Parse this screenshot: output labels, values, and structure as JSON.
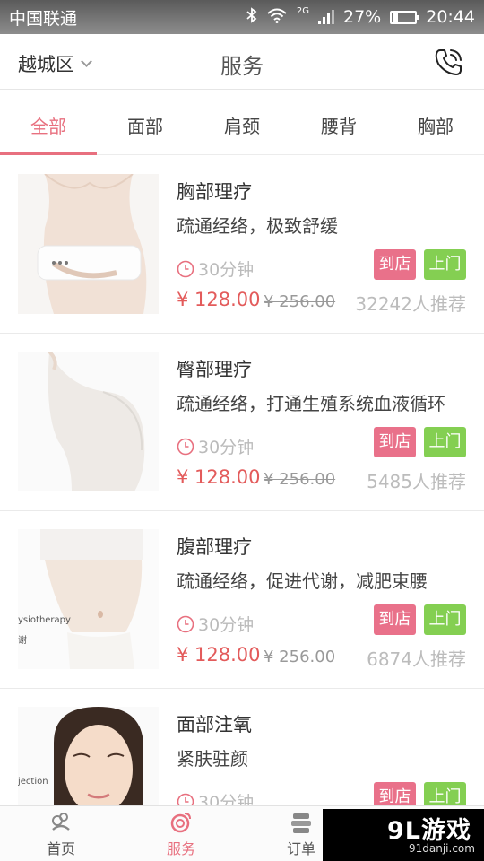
{
  "status_bar": {
    "carrier": "中国联通",
    "network": "2G",
    "battery_percent_text": "27%",
    "battery_level": 0.27,
    "time": "20:44"
  },
  "header": {
    "district": "越城区",
    "title": "服务",
    "call_icon": "phone-call-icon"
  },
  "tabs": [
    {
      "label": "全部",
      "active": true
    },
    {
      "label": "面部",
      "active": false
    },
    {
      "label": "肩颈",
      "active": false
    },
    {
      "label": "腰背",
      "active": false
    },
    {
      "label": "胸部",
      "active": false
    }
  ],
  "services": [
    {
      "name": "胸部理疗",
      "description": "疏通经络，极致舒缓",
      "duration": "30分钟",
      "store_label": "到店",
      "home_label": "上门",
      "price": "¥ 128.00",
      "original_price": "¥ 256.00",
      "recommend": "32242人推荐",
      "overlay": ""
    },
    {
      "name": "臀部理疗",
      "description": "疏通经络，打通生殖系统血液循环",
      "duration": "30分钟",
      "store_label": "到店",
      "home_label": "上门",
      "price": "¥ 128.00",
      "original_price": "¥ 256.00",
      "recommend": "5485人推荐",
      "overlay": ""
    },
    {
      "name": "腹部理疗",
      "description": "疏通经络，促进代谢，减肥束腰",
      "duration": "30分钟",
      "store_label": "到店",
      "home_label": "上门",
      "price": "¥ 128.00",
      "original_price": "¥ 256.00",
      "recommend": "6874人推荐",
      "overlay": "ysiotherapy",
      "overlay2": "谢"
    },
    {
      "name": "面部注氧",
      "description": "紧肤驻颜",
      "duration": "30分钟",
      "store_label": "到店",
      "home_label": "上门",
      "overlay": "jection"
    }
  ],
  "bottom_nav": [
    {
      "label": "首页",
      "icon": "home-icon",
      "active": false
    },
    {
      "label": "服务",
      "icon": "service-icon",
      "active": true
    },
    {
      "label": "订单",
      "icon": "order-icon",
      "active": false
    }
  ],
  "watermark": {
    "logo": "9L游戏",
    "url": "91danji.com"
  },
  "colors": {
    "accent": "#e8707f",
    "store_badge": "#e9718a",
    "home_badge": "#84cf52",
    "price": "#e35b5b"
  }
}
